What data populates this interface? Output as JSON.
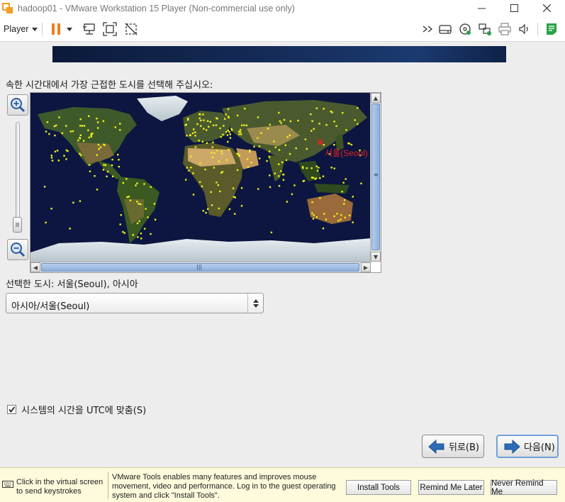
{
  "window": {
    "title": "hadoop01 - VMware Workstation 15 Player (Non-commercial use only)",
    "minimize": "—",
    "maximize": "☐",
    "close": "✕"
  },
  "toolbar": {
    "player_label": "Player",
    "icons": [
      "pause-icon",
      "send-ctrl-alt-del-icon",
      "fit-guest-icon",
      "unity-icon",
      "forward-icon",
      "hard-disk-icon",
      "cd-dvd-icon",
      "network-icon",
      "printer-icon",
      "sound-icon",
      "message-log-icon"
    ],
    "accent_pause": "#f07c1e",
    "accent_log": "#2aa14a"
  },
  "installer": {
    "prompt": "속한 시간대에서 가장 근접한 도시를 선택해 주십시오:",
    "map_city_label": "서울(Seoul)",
    "selected_city_text": "선택한 도시: 서울(Seoul), 아시아",
    "timezone_value": "아시아/서울(Seoul)",
    "utc_checkbox_label": "시스템의 시간을 UTC에 맞춤(S)",
    "utc_checked": true,
    "back_button": "뒤로(B)",
    "next_button": "다음(N)",
    "zoom_in_icon": "zoom-in-icon",
    "zoom_out_icon": "zoom-out-icon",
    "map_ocean_color": "#0c1640",
    "city_dot_color": "#f2f21a",
    "selected_city_color": "#e82222"
  },
  "notification": {
    "hint": "Click in the virtual screen to send keystrokes",
    "message": "VMware Tools enables many features and improves mouse movement, video and performance. Log in to the guest operating system and click \"Install Tools\".",
    "install_button": "Install Tools",
    "remind_later_button": "Remind Me Later",
    "never_remind_button": "Never Remind Me"
  }
}
